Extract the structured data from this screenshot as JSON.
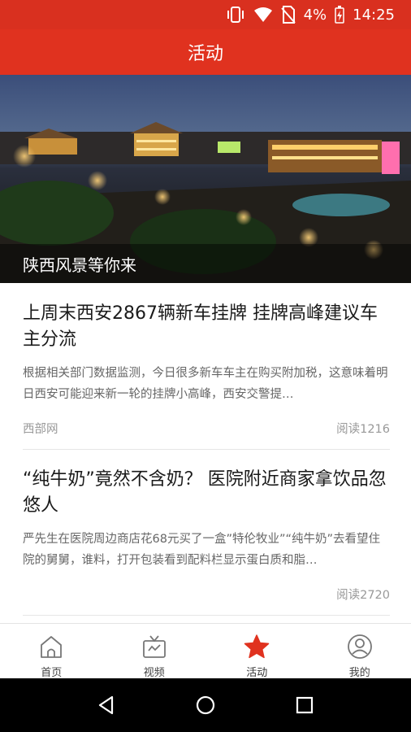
{
  "status_bar": {
    "battery": "4%",
    "time": "14:25"
  },
  "header": {
    "title": "活动"
  },
  "banner": {
    "caption": "陕西风景等你来"
  },
  "articles": [
    {
      "title": "上周末西安2867辆新车挂牌 挂牌高峰建议车主分流",
      "summary": "根据相关部门数据监测，今日很多新车车主在购买附加税，这意味着明日西安可能迎来新一轮的挂牌小高峰，西安交警提…",
      "source": "西部网",
      "reads": "阅读1216"
    },
    {
      "title": "“纯牛奶”竟然不含奶？ 医院附近商家拿饮品忽悠人",
      "summary": "严先生在医院周边商店花68元买了一盒”特伦牧业”“纯牛奶”去看望住院的舅舅，谁料，打开包装看到配料栏显示蛋白质和脂…",
      "source": "",
      "reads": "阅读2720"
    }
  ],
  "tabbar": {
    "items": [
      {
        "label": "首页",
        "icon": "home-icon"
      },
      {
        "label": "视频",
        "icon": "tv-icon"
      },
      {
        "label": "活动",
        "icon": "star-icon"
      },
      {
        "label": "我的",
        "icon": "profile-icon"
      }
    ],
    "active_color": "#e0321f"
  },
  "colors": {
    "brand": "#e0321f"
  }
}
